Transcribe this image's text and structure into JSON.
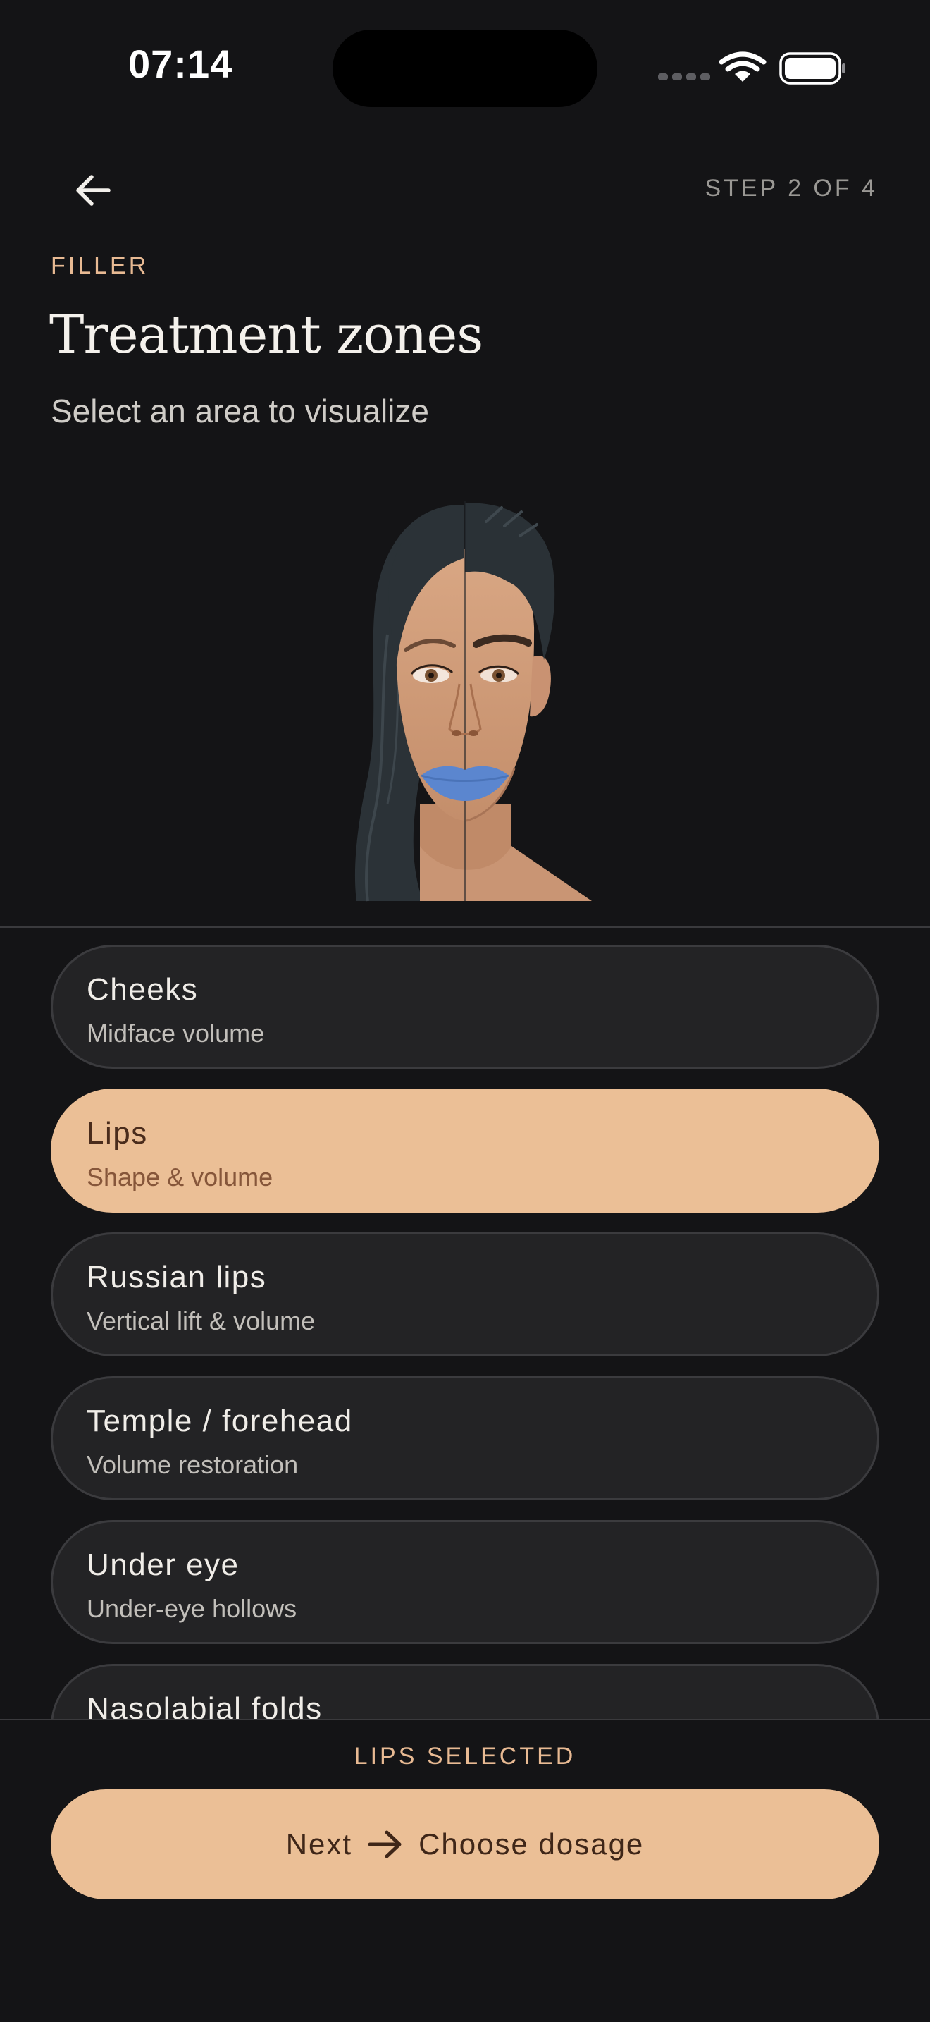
{
  "status_bar": {
    "time": "07:14",
    "signal_icon": "signal-dots-icon",
    "wifi_icon": "wifi-icon",
    "battery_icon": "battery-icon"
  },
  "header": {
    "back_icon": "arrow-left-icon",
    "step": "STEP 2 OF 4",
    "category": "FILLER",
    "title": "Treatment zones",
    "subtitle": "Select an area to visualize"
  },
  "face": {
    "highlighted_zone": "Lips",
    "highlight_color": "#5b86cf"
  },
  "zones": [
    {
      "name": "Cheeks",
      "description": "Midface volume",
      "selected": false
    },
    {
      "name": "Lips",
      "description": "Shape & volume",
      "selected": true
    },
    {
      "name": "Russian lips",
      "description": "Vertical lift & volume",
      "selected": false
    },
    {
      "name": "Temple / forehead",
      "description": "Volume restoration",
      "selected": false
    },
    {
      "name": "Under eye",
      "description": "Under-eye hollows",
      "selected": false
    },
    {
      "name": "Nasolabial folds",
      "description": "",
      "selected": false
    }
  ],
  "footer": {
    "selection_status": "LIPS SELECTED",
    "next_label": "Next",
    "next_icon": "arrow-right-icon",
    "next_target": "Choose dosage"
  },
  "colors": {
    "background": "#141416",
    "card": "#232325",
    "accent": "#ebbf96",
    "accent_text": "#e8ba93"
  }
}
